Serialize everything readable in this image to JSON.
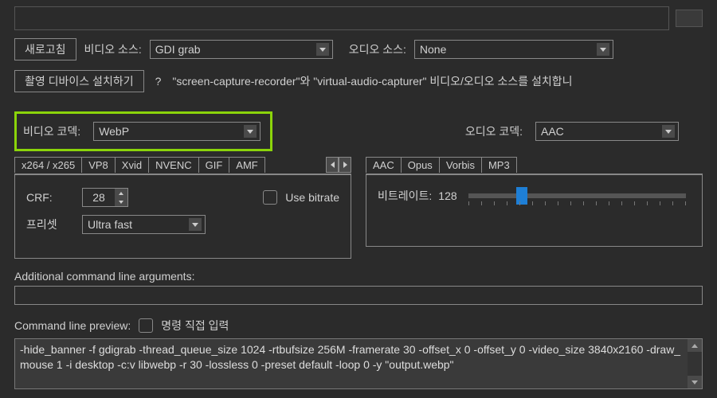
{
  "top": {
    "refresh_btn": "새로고침",
    "video_source_label": "비디오 소스:",
    "video_source_value": "GDI grab",
    "audio_source_label": "오디오 소스:",
    "audio_source_value": "None",
    "install_device_btn": "촬영 디바이스 설치하기",
    "help_q": "?",
    "install_hint": "\"screen-capture-recorder\"와 \"virtual-audio-capturer\" 비디오/오디오 소스를 설치합니"
  },
  "video_codec": {
    "label": "비디오 코덱:",
    "value": "WebP"
  },
  "audio_codec": {
    "label": "오디오 코덱:",
    "value": "AAC"
  },
  "video_tabs": [
    "x264 / x265",
    "VP8",
    "Xvid",
    "NVENC",
    "GIF",
    "AMF"
  ],
  "video_panel": {
    "crf_label": "CRF:",
    "crf_value": "28",
    "use_bitrate_label": "Use bitrate",
    "preset_label": "프리셋",
    "preset_value": "Ultra fast"
  },
  "audio_tabs": [
    "AAC",
    "Opus",
    "Vorbis",
    "MP3"
  ],
  "audio_panel": {
    "bitrate_label": "비트레이트:",
    "bitrate_value": "128"
  },
  "additional_args_label": "Additional command line arguments:",
  "cmd_preview_label": "Command line preview:",
  "manual_input_label": "명령 직접 입력",
  "cmd_preview_text": "-hide_banner -f gdigrab -thread_queue_size 1024 -rtbufsize 256M -framerate 30 -offset_x 0 -offset_y 0 -video_size 3840x2160 -draw_mouse 1 -i desktop -c:v libwebp -r 30 -lossless 0 -preset default -loop 0 -y \"output.webp\""
}
